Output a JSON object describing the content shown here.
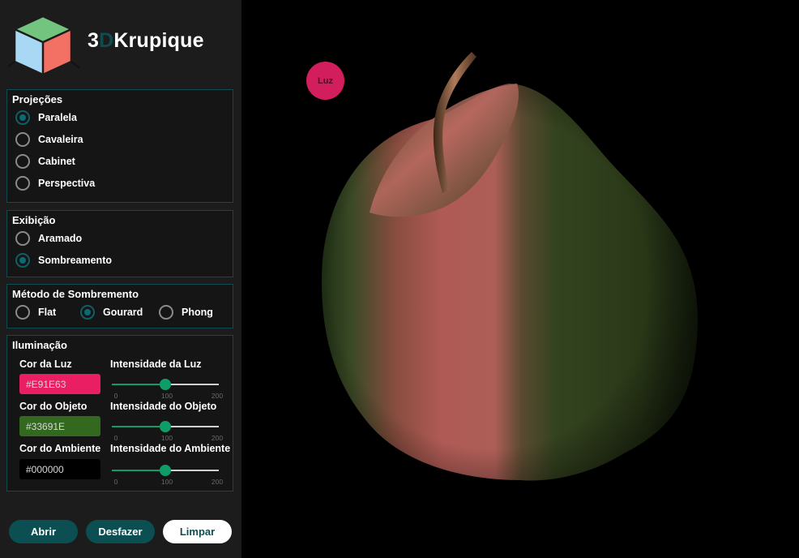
{
  "brand": {
    "prefix": "3",
    "accent": "D",
    "name": "Krupique"
  },
  "projections": {
    "title": "Projeções",
    "options": [
      "Paralela",
      "Cavaleira",
      "Cabinet",
      "Perspectiva"
    ],
    "selected": "Paralela"
  },
  "display": {
    "title": "Exibição",
    "options": [
      "Aramado",
      "Sombreamento"
    ],
    "selected": "Sombreamento"
  },
  "shading": {
    "title": "Método de Sombremento",
    "options": [
      "Flat",
      "Gourard",
      "Phong"
    ],
    "selected": "Gourard"
  },
  "lighting": {
    "title": "Iluminação",
    "light_color_label": "Cor da Luz",
    "light_color": "#E91E63",
    "light_intensity_label": "Intensidade da Luz",
    "light_intensity": 100,
    "object_color_label": "Cor do Objeto",
    "object_color": "#33691E",
    "object_intensity_label": "Intensidade do Objeto",
    "object_intensity": 100,
    "ambient_color_label": "Cor do Ambiente",
    "ambient_color": "#000000",
    "ambient_intensity_label": "Intensidade do Ambiente",
    "ambient_intensity": 100,
    "slider_min": "0",
    "slider_mid": "100",
    "slider_max": "200"
  },
  "buttons": {
    "open": "Abrir",
    "undo": "Desfazer",
    "clear": "Limpar"
  },
  "viewport": {
    "light_handle_label": "Luz"
  },
  "colors": {
    "accent_teal": "#0c4f52",
    "slider_green": "#0e9d66",
    "light_handle": "#d21e5c",
    "apple_dark": "#2a3c1c",
    "apple_highlight": "#b05a55"
  }
}
